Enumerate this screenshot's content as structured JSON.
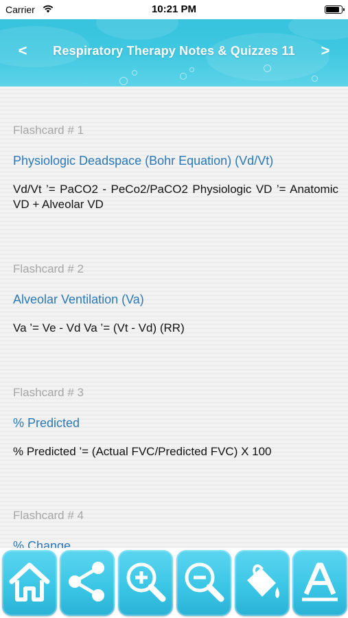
{
  "status_bar": {
    "carrier": "Carrier",
    "time": "10:21 PM"
  },
  "header": {
    "title": "Respiratory Therapy Notes & Quizzes 11",
    "prev_icon": "chevron-left-icon",
    "next_icon": "chevron-right-icon",
    "prev_label": "<",
    "next_label": ">"
  },
  "flashcards": [
    {
      "number": "Flashcard # 1",
      "title": "Physiologic Deadspace (Bohr Equation) (Vd/Vt)",
      "body": "Vd/Vt ’= PaCO2 - PeCo2/PaCO2 Physiologic VD ’= Anatomic VD + Alveolar VD"
    },
    {
      "number": "Flashcard # 2",
      "title": "Alveolar Ventilation (Va)",
      "body": "Va ’= Ve - Vd Va ’= (Vt - Vd) (RR)"
    },
    {
      "number": "Flashcard # 3",
      "title": "% Predicted",
      "body": "% Predicted ’= (Actual FVC/Predicted FVC) X 100"
    },
    {
      "number": "Flashcard # 4",
      "title": "% Change",
      "body": ""
    }
  ],
  "toolbar": {
    "buttons": [
      "home-icon",
      "share-icon",
      "zoom-in-icon",
      "zoom-out-icon",
      "paint-bucket-icon",
      "font-icon"
    ]
  },
  "colors": {
    "header_bg": "#3fc8e1",
    "card_title": "#2a78b8",
    "card_number": "#a6a6a6",
    "toolbar_button": "#3bc6e6"
  }
}
